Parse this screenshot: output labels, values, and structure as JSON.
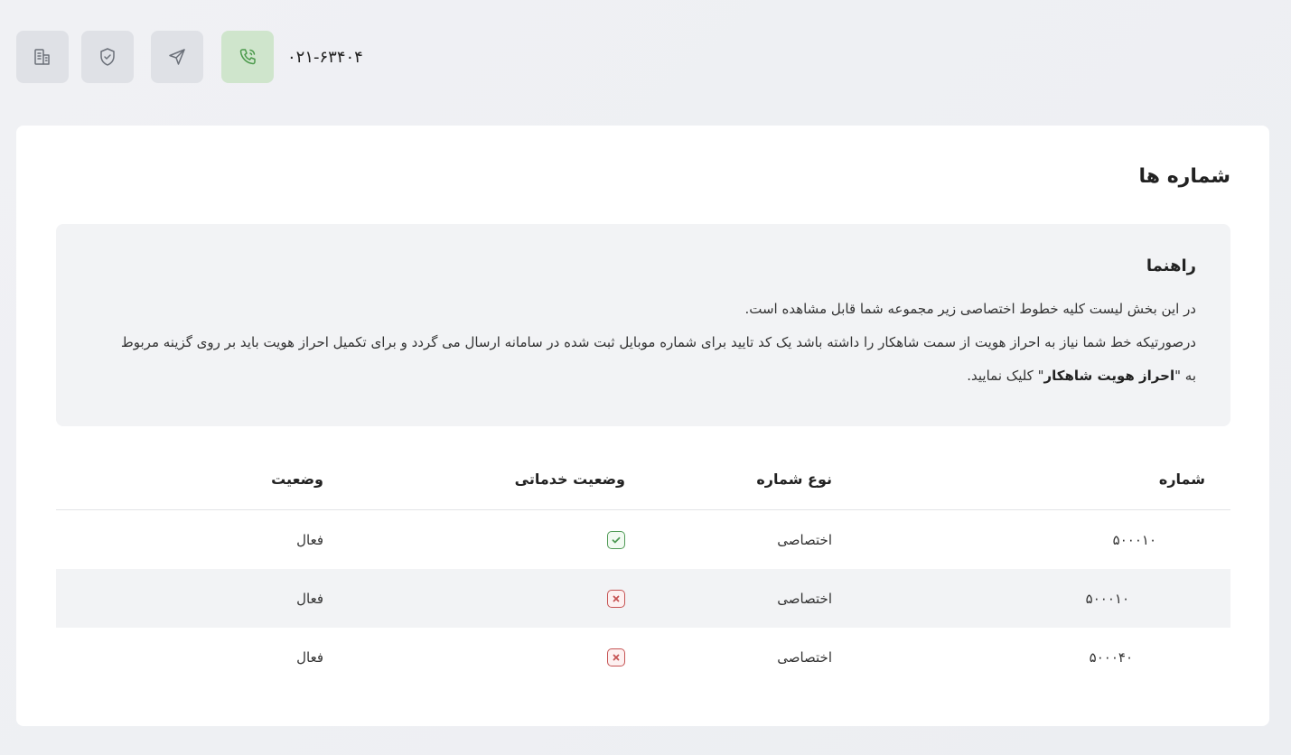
{
  "header": {
    "phone_number": "۰۲۱-۶۳۴۰۴",
    "buttons": [
      {
        "icon": "building-icon"
      },
      {
        "icon": "shield-check-icon"
      },
      {
        "icon": "send-icon"
      },
      {
        "icon": "phone-call-icon",
        "active": true
      }
    ]
  },
  "page": {
    "title": "شماره ها"
  },
  "guide": {
    "title": "راهنما",
    "line1": "در این بخش لیست کلیه خطوط اختصاصی زیر مجموعه شما قابل مشاهده است.",
    "line2_part1": "درصورتیکه خط شما نیاز به احراز هویت از سمت شاهکار را داشته باشد یک کد تایید برای شماره موبایل ثبت شده در سامانه ارسال می گردد و برای تکمیل احراز هویت باید بر روی گزینه مربوط به \"",
    "line2_bold": "احراز هویت شاهکار",
    "line2_part2": "\" کلیک نمایید."
  },
  "table": {
    "columns": {
      "number": "شماره",
      "type": "نوع شماره",
      "service_status": "وضعیت خدماتی",
      "status": "وضعیت"
    },
    "rows": [
      {
        "number": "۵۰۰۰۱۰",
        "type": "اختصاصی",
        "service_ok": true,
        "status": "فعال"
      },
      {
        "number": "۵۰۰۰۱۰",
        "type": "اختصاصی",
        "service_ok": false,
        "status": "فعال"
      },
      {
        "number": "۵۰۰۰۴۰",
        "type": "اختصاصی",
        "service_ok": false,
        "status": "فعال"
      }
    ]
  },
  "colors": {
    "accent_green": "#4b9a4b",
    "error_red": "#c65353"
  }
}
